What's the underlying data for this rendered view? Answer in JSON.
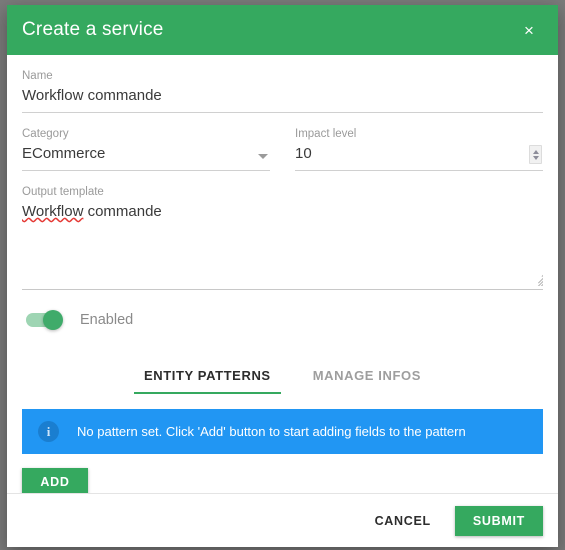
{
  "dialog": {
    "title": "Create a service",
    "close_icon": "close-icon",
    "header_color": "#35a95f"
  },
  "form": {
    "name": {
      "label": "Name",
      "value": "Workflow commande",
      "placeholder": ""
    },
    "category": {
      "label": "Category",
      "value": "ECommerce",
      "caret_icon": "chevron-down-icon"
    },
    "impact_level": {
      "label": "Impact level",
      "value": "10",
      "stepper_icon": "spinner-arrows-icon"
    },
    "output_template": {
      "label": "Output template",
      "value": "Workflow commande",
      "misspelled_word": "Workflow",
      "rest_text": " commande",
      "resize_icon": "resize-grip-icon"
    },
    "enabled_toggle": {
      "label": "Enabled",
      "state": "on",
      "track_color": "#9ed5b3",
      "thumb_color": "#3fab6a"
    }
  },
  "tabs": [
    {
      "label": "ENTITY PATTERNS",
      "active": true
    },
    {
      "label": "MANAGE INFOS",
      "active": false
    }
  ],
  "info_banner": {
    "icon": "info-circle-icon",
    "icon_glyph": "i",
    "message": "No pattern set. Click 'Add' button to start adding fields to the pattern",
    "background_color": "#2196f3"
  },
  "actions": {
    "add_label": "ADD",
    "cancel_label": "CANCEL",
    "submit_label": "SUBMIT",
    "accent_color": "#35a95f"
  }
}
